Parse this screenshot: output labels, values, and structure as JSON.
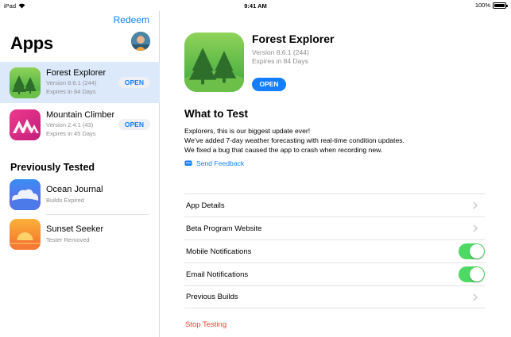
{
  "status_bar": {
    "carrier": "iPad",
    "time": "9:41 AM",
    "battery": "100%"
  },
  "sidebar": {
    "redeem_label": "Redeem",
    "title": "Apps",
    "apps": [
      {
        "name": "Forest Explorer",
        "version": "Version 8.6.1 (244)",
        "expires": "Expires in 84 Days",
        "button": "OPEN",
        "selected": true
      },
      {
        "name": "Mountain Climber",
        "version": "Version 2.4.1 (43)",
        "expires": "Expires in 45 Days",
        "button": "OPEN",
        "selected": false
      }
    ],
    "previously_tested_title": "Previously Tested",
    "previous": [
      {
        "name": "Ocean Journal",
        "status": "Builds Expired"
      },
      {
        "name": "Sunset Seeker",
        "status": "Tester Removed"
      }
    ]
  },
  "detail": {
    "app_name": "Forest Explorer",
    "version": "Version 8.6.1 (244)",
    "expires": "Expires in 84 Days",
    "open_label": "OPEN",
    "what_to_test_title": "What to Test",
    "what_to_test_lines": [
      "Explorers, this is our biggest update ever!",
      "We’ve added 7-day weather forecasting with real-time condition updates.",
      "We fixed a bug that caused the app to crash when recording new."
    ],
    "send_feedback_label": "Send Feedback",
    "rows": [
      {
        "label": "App Details",
        "accessory": "chevron"
      },
      {
        "label": "Beta Program Website",
        "accessory": "chevron"
      },
      {
        "label": "Mobile Notifications",
        "accessory": "toggle",
        "on": true
      },
      {
        "label": "Email Notifications",
        "accessory": "toggle",
        "on": true
      },
      {
        "label": "Previous Builds",
        "accessory": "chevron"
      }
    ],
    "stop_testing_label": "Stop Testing"
  },
  "colors": {
    "accent": "#147efb",
    "toggle_on": "#4cd964",
    "destructive": "#ff3b30",
    "selected_row": "#dbe9fb",
    "secondary_text": "#8e8e93"
  }
}
